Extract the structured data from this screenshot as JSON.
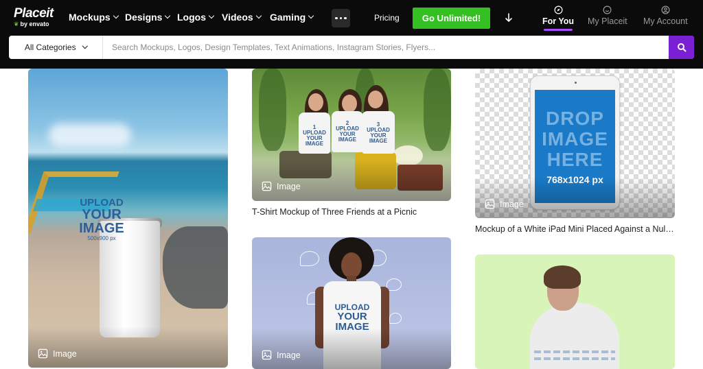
{
  "brand": {
    "name": "Placeit",
    "sub": "by envato"
  },
  "nav": {
    "items": [
      {
        "label": "Mockups"
      },
      {
        "label": "Designs"
      },
      {
        "label": "Logos"
      },
      {
        "label": "Videos"
      },
      {
        "label": "Gaming"
      }
    ],
    "pricing": "Pricing",
    "cta": "Go Unlimited!",
    "for_you": "For You",
    "my_placeit": "My Placeit",
    "my_account": "My Account"
  },
  "search": {
    "category": "All Categories",
    "placeholder": "Search Mockups, Logos, Design Templates, Text Animations, Instagram Stories, Flyers..."
  },
  "cards": [
    {
      "badge": "Image",
      "upload": [
        "UPLOAD",
        "YOUR",
        "IMAGE"
      ],
      "size": "500x900 px"
    },
    {
      "badge": "Image",
      "title": "T-Shirt Mockup of Three Friends at a Picnic",
      "nums": [
        "1",
        "2",
        "3"
      ],
      "mini": [
        "UPLOAD",
        "YOUR",
        "IMAGE"
      ]
    },
    {
      "badge": "Image",
      "title": "Mockup of a White iPad Mini Placed Against a Nul…",
      "drop": [
        "DROP",
        "IMAGE",
        "HERE"
      ],
      "size": "768x1024 px"
    },
    {
      "badge": "Image",
      "upload": [
        "UPLOAD",
        "YOUR",
        "IMAGE"
      ]
    },
    {}
  ],
  "colors": {
    "accent": "#7a1fd4",
    "cta": "#34c021",
    "nav_bg": "#0b0b0b",
    "underline": "#a64dff"
  }
}
